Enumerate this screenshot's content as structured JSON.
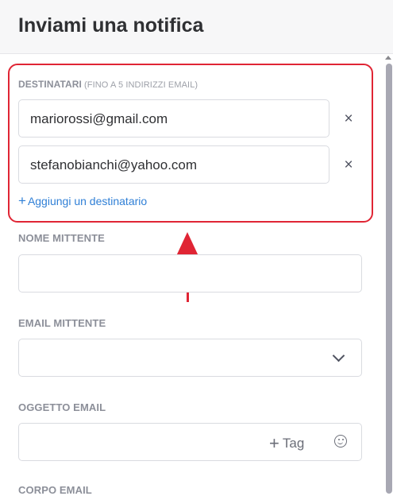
{
  "header": {
    "title": "Inviami una notifica"
  },
  "recipients": {
    "label": "DESTINATARI",
    "hint": "(FINO A 5 INDIRIZZI EMAIL)",
    "emails": [
      "mariorossi@gmail.com",
      "stefanobianchi@yahoo.com"
    ],
    "remove_icon": "×",
    "add_link": "Aggiungi un destinatario",
    "add_icon": "+"
  },
  "sender_name": {
    "label": "NOME MITTENTE",
    "value": ""
  },
  "sender_email": {
    "label": "EMAIL MITTENTE",
    "value": "",
    "icon": "chevron-down-icon"
  },
  "subject": {
    "label": "OGGETTO EMAIL",
    "value": "",
    "tag_label": "Tag",
    "tag_icon": "+",
    "emoji_icon": "smiley-icon"
  },
  "body": {
    "label": "CORPO EMAIL"
  },
  "annotation": {
    "color": "#e02534"
  },
  "colors": {
    "accent": "#2f7fd6",
    "label": "#8c8f99"
  }
}
